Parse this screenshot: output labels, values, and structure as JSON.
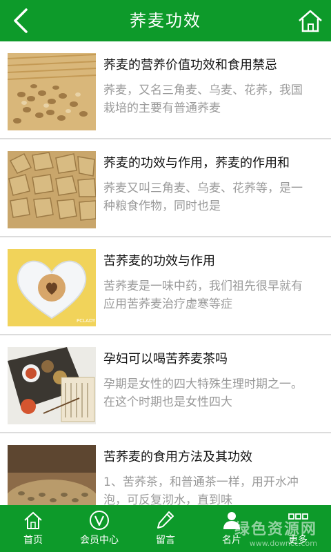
{
  "header": {
    "title": "荞麦功效",
    "back_icon": "chevron-left-icon",
    "home_icon": "home-icon",
    "bg_color": "#0d9a2a"
  },
  "articles": [
    {
      "title": "荞麦的营养价值功效和食用禁忌",
      "snippet": "荞麦，又名三角麦、乌麦、花荞，我国栽培的主要有普通荞麦",
      "thumb": "buckwheat-on-mat"
    },
    {
      "title": "荞麦的功效与作用，荞麦的作用和",
      "snippet": "荞麦又叫三角麦、乌麦、花荞等，是一种粮食作物，同时也是",
      "thumb": "buckwheat-closeup"
    },
    {
      "title": "苦荞麦的功效与作用",
      "snippet": "苦荞麦是一味中药，我们祖先很早就有应用苦荞麦治疗虚寒等症",
      "thumb": "heart-dish-cookie",
      "thumb_caption": "PCLADY"
    },
    {
      "title": "孕妇可以喝苦荞麦茶吗",
      "snippet": "孕期是女性的四大特殊生理时期之一。在这个时期也是女性四大",
      "thumb": "herbal-medicine-tray"
    },
    {
      "title": "苦荞麦的食用方法及其功效",
      "snippet": "1、苦荞茶，和普通茶一样，用开水冲泡，可反复沏水，直到味",
      "thumb": "buckwheat-bowl"
    }
  ],
  "bottom_nav": [
    {
      "label": "首页",
      "icon": "home-outline-icon"
    },
    {
      "label": "会员中心",
      "icon": "member-v-icon"
    },
    {
      "label": "留言",
      "icon": "pencil-icon"
    },
    {
      "label": "名片",
      "icon": "person-card-icon"
    },
    {
      "label": "更多",
      "icon": "grid-more-icon"
    }
  ],
  "watermark": {
    "text": "绿色资源网",
    "sub": "www.downcc.com"
  }
}
